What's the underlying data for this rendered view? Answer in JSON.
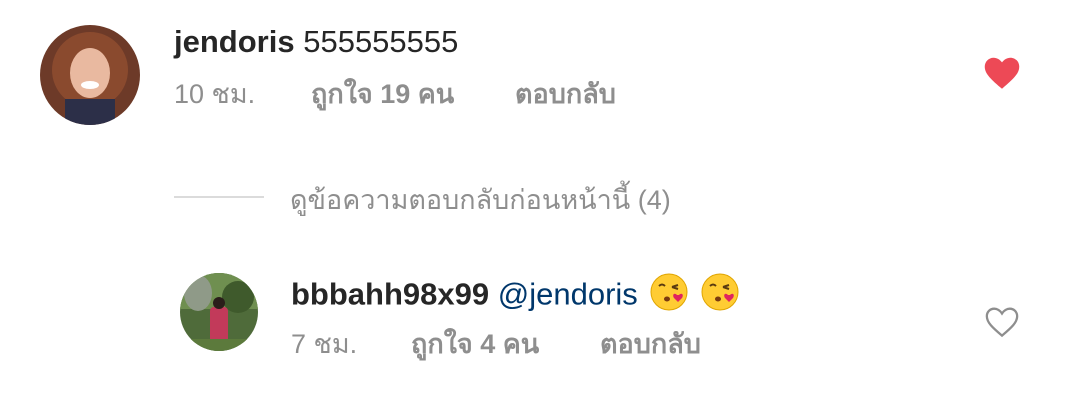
{
  "comment": {
    "username": "jendoris",
    "text": "555555555",
    "time": "10 ชม.",
    "likes": "ถูกใจ 19 คน",
    "reply": "ตอบกลับ",
    "liked": true,
    "heart_color": "#ed4956"
  },
  "view_replies": "ดูข้อความตอบกลับก่อนหน้านี้ (4)",
  "reply_comment": {
    "username": "bbbahh98x99",
    "mention": "@jendoris",
    "emojis": [
      "face-blowing-kiss-emoji",
      "face-blowing-kiss-emoji"
    ],
    "time": "7 ชม.",
    "likes": "ถูกใจ 4 คน",
    "reply": "ตอบกลับ",
    "liked": false,
    "heart_color": "#8e8e8e"
  }
}
